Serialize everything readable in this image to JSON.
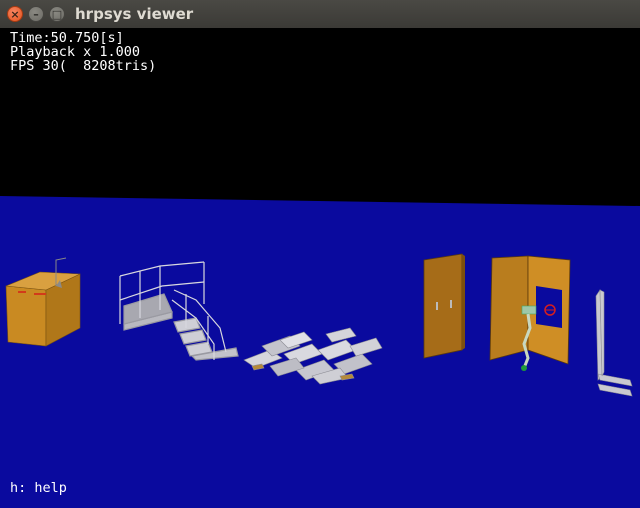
{
  "window": {
    "title": "hrpsys viewer",
    "close_glyph": "×",
    "minimize_glyph": "–",
    "maximize_glyph": "□"
  },
  "hud": {
    "time": "Time:50.750[s]",
    "playback": "Playback x 1.000",
    "fps": "FPS 30(  8208tris)",
    "help": "h: help"
  },
  "colors": {
    "floor": "#0a0a9e",
    "sky": "#000000",
    "wood": "#c98a22",
    "metal": "#c6c6cc"
  }
}
